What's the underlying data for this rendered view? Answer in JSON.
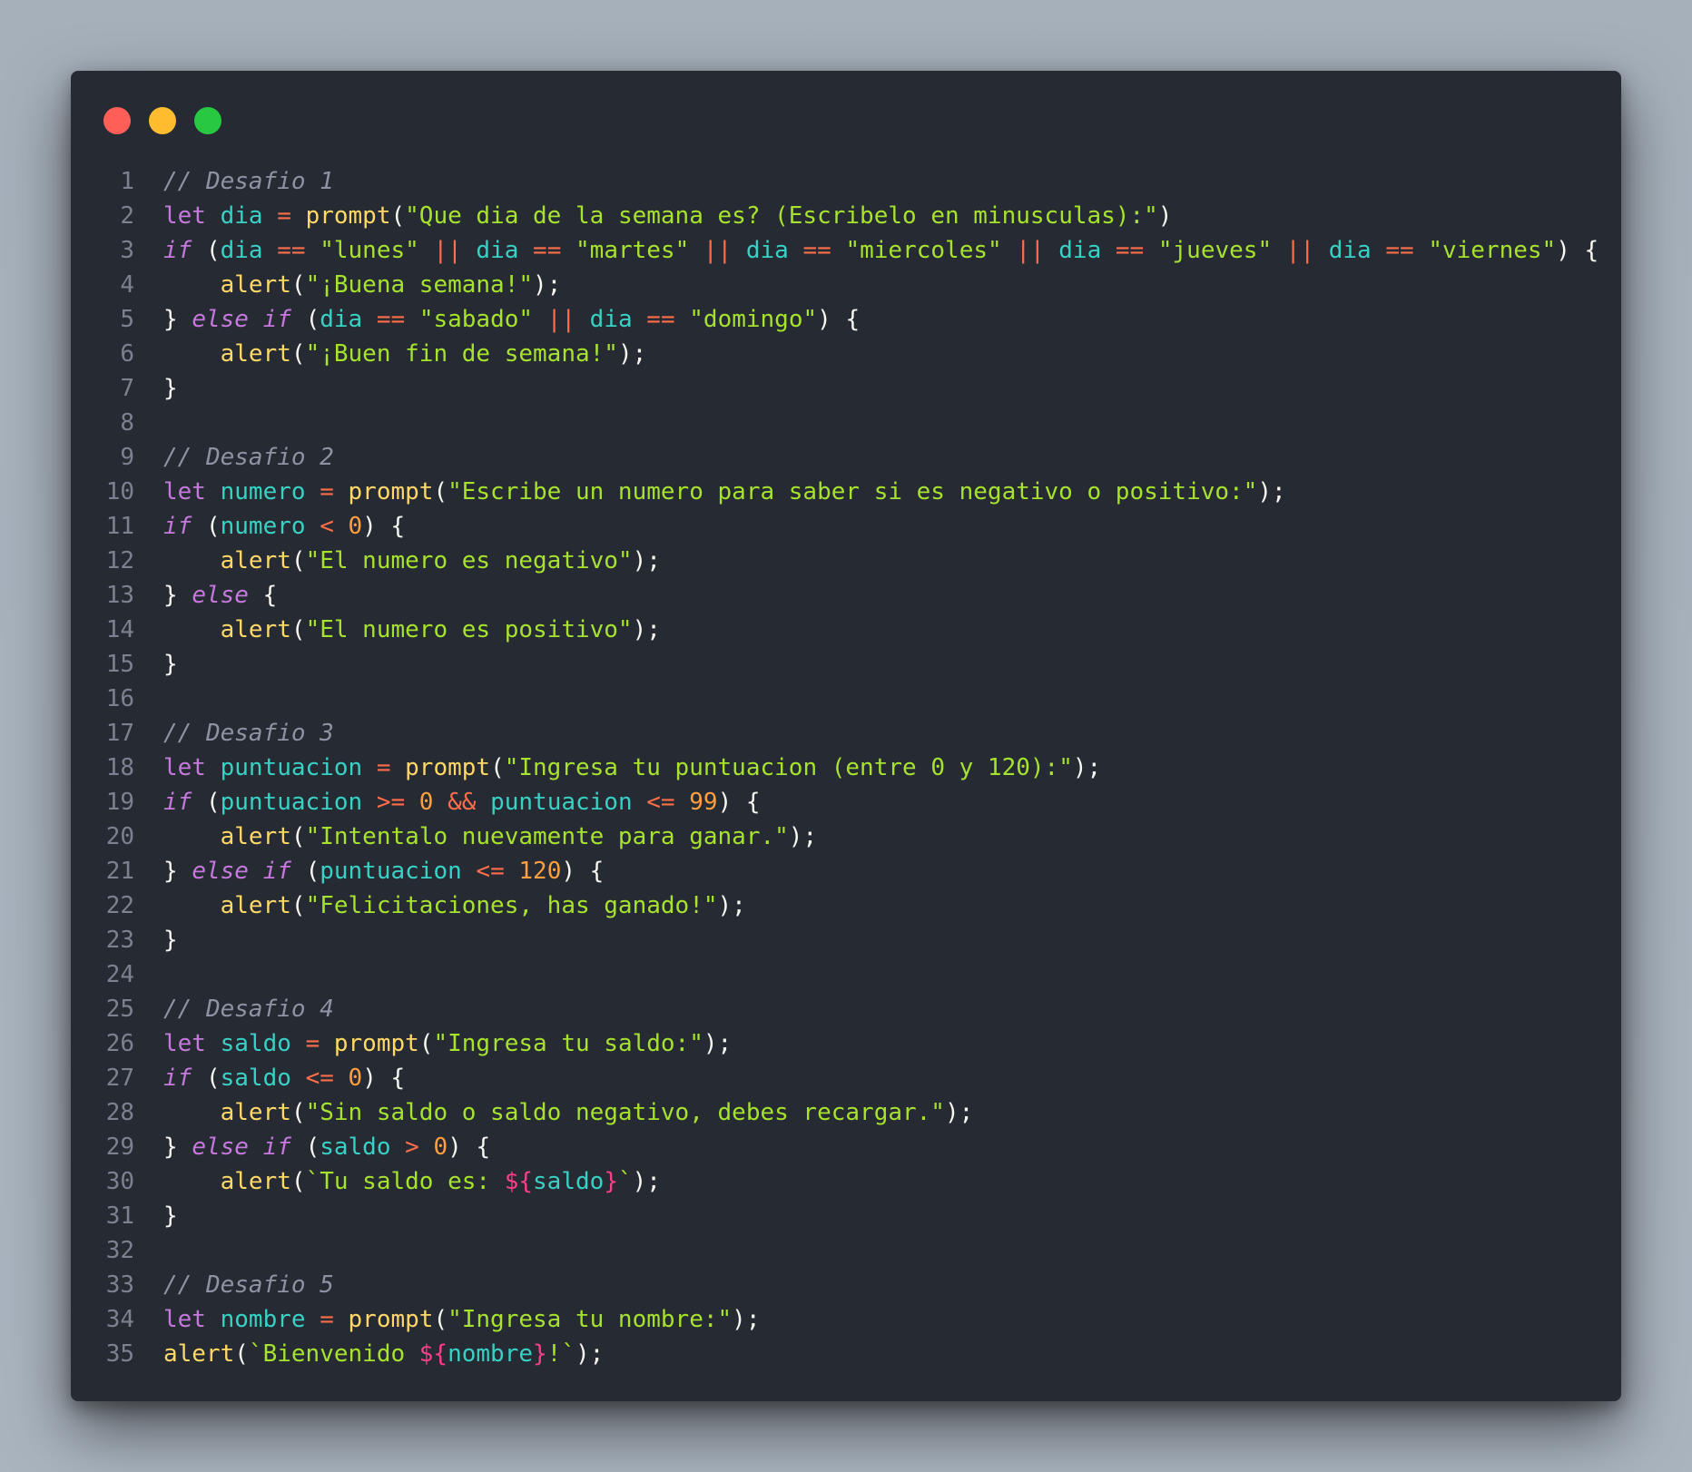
{
  "window": {
    "buttons": {
      "close_color": "#ff5f57",
      "minimize_color": "#febc2e",
      "maximize_color": "#28c840"
    }
  },
  "code": {
    "language": "javascript",
    "lines": [
      {
        "number": "1",
        "text": "// Desafio 1"
      },
      {
        "number": "2",
        "text": "let dia = prompt(\"Que dia de la semana es? (Escribelo en minusculas):\")"
      },
      {
        "number": "3",
        "text": "if (dia == \"lunes\" || dia == \"martes\" || dia == \"miercoles\" || dia == \"jueves\" || dia == \"viernes\") {"
      },
      {
        "number": "4",
        "text": "    alert(\"¡Buena semana!\");"
      },
      {
        "number": "5",
        "text": "} else if (dia == \"sabado\" || dia == \"domingo\") {"
      },
      {
        "number": "6",
        "text": "    alert(\"¡Buen fin de semana!\");"
      },
      {
        "number": "7",
        "text": "}"
      },
      {
        "number": "8",
        "text": ""
      },
      {
        "number": "9",
        "text": "// Desafio 2"
      },
      {
        "number": "10",
        "text": "let numero = prompt(\"Escribe un numero para saber si es negativo o positivo:\");"
      },
      {
        "number": "11",
        "text": "if (numero < 0) {"
      },
      {
        "number": "12",
        "text": "    alert(\"El numero es negativo\");"
      },
      {
        "number": "13",
        "text": "} else {"
      },
      {
        "number": "14",
        "text": "    alert(\"El numero es positivo\");"
      },
      {
        "number": "15",
        "text": "}"
      },
      {
        "number": "16",
        "text": ""
      },
      {
        "number": "17",
        "text": "// Desafio 3"
      },
      {
        "number": "18",
        "text": "let puntuacion = prompt(\"Ingresa tu puntuacion (entre 0 y 120):\");"
      },
      {
        "number": "19",
        "text": "if (puntuacion >= 0 && puntuacion <= 99) {"
      },
      {
        "number": "20",
        "text": "    alert(\"Intentalo nuevamente para ganar.\");"
      },
      {
        "number": "21",
        "text": "} else if (puntuacion <= 120) {"
      },
      {
        "number": "22",
        "text": "    alert(\"Felicitaciones, has ganado!\");"
      },
      {
        "number": "23",
        "text": "}"
      },
      {
        "number": "24",
        "text": ""
      },
      {
        "number": "25",
        "text": "// Desafio 4"
      },
      {
        "number": "26",
        "text": "let saldo = prompt(\"Ingresa tu saldo:\");"
      },
      {
        "number": "27",
        "text": "if (saldo <= 0) {"
      },
      {
        "number": "28",
        "text": "    alert(\"Sin saldo o saldo negativo, debes recargar.\");"
      },
      {
        "number": "29",
        "text": "} else if (saldo > 0) {"
      },
      {
        "number": "30",
        "text": "    alert(`Tu saldo es: ${saldo}`);"
      },
      {
        "number": "31",
        "text": "}"
      },
      {
        "number": "32",
        "text": ""
      },
      {
        "number": "33",
        "text": "// Desafio 5"
      },
      {
        "number": "34",
        "text": "let nombre = prompt(\"Ingresa tu nombre:\");"
      },
      {
        "number": "35",
        "text": "alert(`Bienvenido ${nombre}!`);"
      }
    ]
  }
}
